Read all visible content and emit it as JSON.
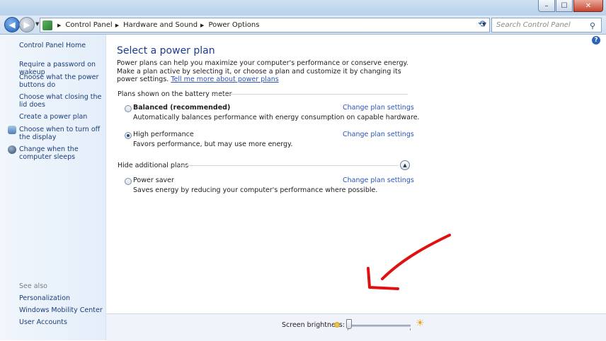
{
  "titlebar": {
    "min_label": "–",
    "max_label": "☐",
    "close_label": "✕"
  },
  "address": {
    "crumbs": [
      "Control Panel",
      "Hardware and Sound",
      "Power Options"
    ],
    "search_placeholder": "Search Control Panel"
  },
  "sidebar": {
    "items": [
      {
        "label": "Control Panel Home"
      },
      {
        "label": "Require a password on wakeup"
      },
      {
        "label": "Choose what the power buttons do"
      },
      {
        "label": "Choose what closing the lid does"
      },
      {
        "label": "Create a power plan"
      },
      {
        "label": "Choose when to turn off the display"
      },
      {
        "label": "Change when the computer sleeps"
      }
    ],
    "see_also_label": "See also",
    "see_also": [
      {
        "label": "Personalization"
      },
      {
        "label": "Windows Mobility Center"
      },
      {
        "label": "User Accounts"
      }
    ]
  },
  "main": {
    "title": "Select a power plan",
    "intro": "Power plans can help you maximize your computer's performance or conserve energy. Make a plan active by selecting it, or choose a plan and customize it by changing its power settings. ",
    "intro_link": "Tell me more about power plans",
    "battery_group": "Plans shown on the battery meter",
    "additional_group": "Hide additional plans",
    "plans": [
      {
        "name": "Balanced (recommended)",
        "desc": "Automatically balances performance with energy consumption on capable hardware.",
        "link": "Change plan settings",
        "selected": false
      },
      {
        "name": "High performance",
        "desc": "Favors performance, but may use more energy.",
        "link": "Change plan settings",
        "selected": true
      },
      {
        "name": "Power saver",
        "desc": "Saves energy by reducing your computer's performance where possible.",
        "link": "Change plan settings",
        "selected": false
      }
    ]
  },
  "bottom": {
    "brightness_label": "Screen brightness:",
    "brightness_level": 0
  },
  "colors": {
    "link": "#2a55b9",
    "title": "#1b3c8c",
    "annotation_arrow": "#e01010"
  }
}
